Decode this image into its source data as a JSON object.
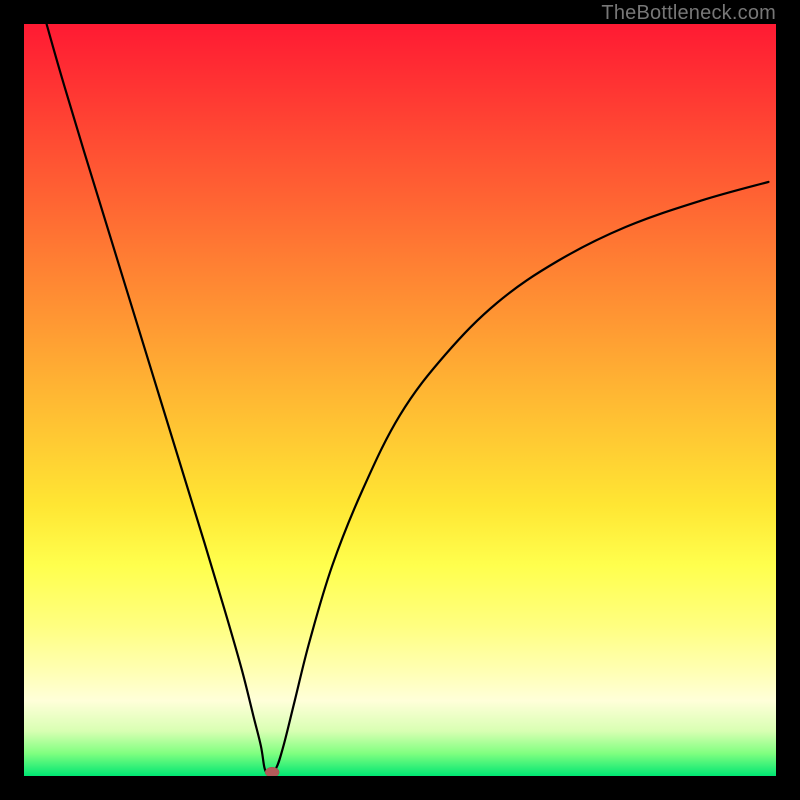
{
  "watermark": "TheBottleneck.com",
  "chart_data": {
    "type": "line",
    "title": "",
    "xlabel": "",
    "ylabel": "",
    "xlim": [
      0,
      100
    ],
    "ylim": [
      0,
      100
    ],
    "series": [
      {
        "name": "curve",
        "x": [
          3,
          5,
          8,
          12,
          16,
          20,
          24,
          27,
          29,
          30.5,
          31.5,
          32,
          32.5,
          33.5,
          34.5,
          36,
          38,
          41,
          45,
          50,
          56,
          63,
          71,
          80,
          90,
          99
        ],
        "values": [
          100,
          93,
          83,
          70,
          57,
          44,
          31,
          21,
          14,
          8,
          4,
          1,
          0.5,
          1,
          4,
          10,
          18,
          28,
          38,
          48,
          56,
          63,
          68.5,
          73,
          76.5,
          79
        ]
      }
    ],
    "marker": {
      "x": 33,
      "y": 0.5,
      "color": "#b35a5a"
    },
    "background_gradient": {
      "stops": [
        {
          "pos": 0,
          "color": "#ff1a33"
        },
        {
          "pos": 50,
          "color": "#ffcc33"
        },
        {
          "pos": 80,
          "color": "#ffff80"
        },
        {
          "pos": 100,
          "color": "#00e673"
        }
      ]
    }
  }
}
